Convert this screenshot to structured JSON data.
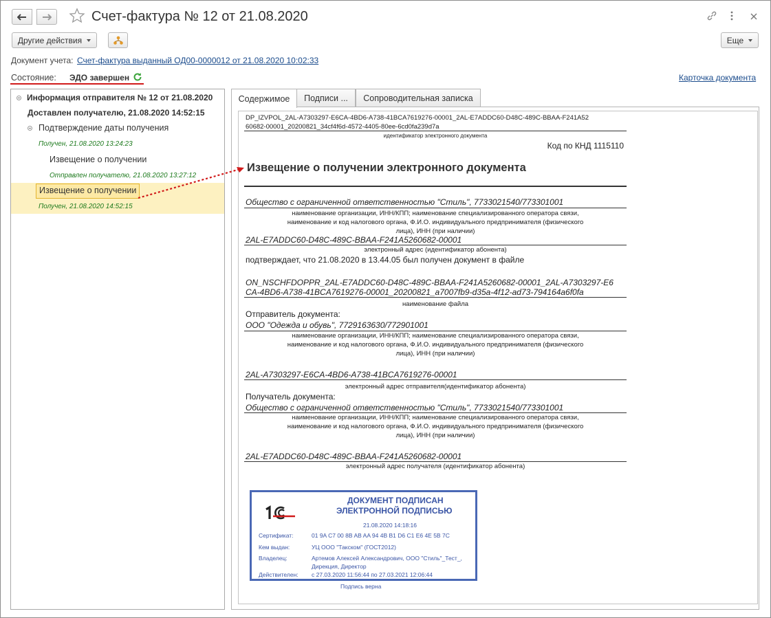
{
  "header": {
    "title": "Счет-фактура № 12 от 21.08.2020"
  },
  "toolbar": {
    "other_actions": "Другие действия",
    "more": "Еще"
  },
  "doc_account": {
    "label": "Документ учета:",
    "link": "Счет-фактура выданный ОД00-0000012 от 21.08.2020 10:02:33"
  },
  "state": {
    "label": "Состояние:",
    "value": "ЭДО завершен"
  },
  "doc_card_link": "Карточка документа",
  "tree": {
    "sender_info": "Информация отправителя № 12 от 21.08.2020",
    "delivered": "Доставлен получателю, 21.08.2020 14:52:15",
    "confirm_date": "Подтверждение даты получения",
    "received_1": "Получен, 21.08.2020 13:24:23",
    "notice_1": "Извещение о получении",
    "sent_1": "Отправлен получателю, 21.08.2020 13:27:12",
    "notice_2": "Извещение о получении",
    "received_2": "Получен, 21.08.2020 14:52:15"
  },
  "tabs": [
    "Содержимое",
    "Подписи ...",
    "Сопроводительная записка"
  ],
  "document": {
    "file_id_line1": "DP_IZVPOL_2AL-A7303297-E6CA-4BD6-A738-41BCA7619276-00001_2AL-E7ADDC60-D48C-489C-BBAA-F241A52",
    "file_id_line2": "60682-00001_20200821_34cf4f6d-4572-4405-80ee-6cd0fa239d7a",
    "file_id_caption": "идентификатор электронного документа",
    "knd": "Код по КНД 1115110",
    "heading": "Извещение о получении электронного документа",
    "org_1": "Общество с ограниченной ответственностью \"Стиль\", 7733021540/773301001",
    "org_caption_1": "наименование организации, ИНН/КПП; наименование специализированного оператора связи, наименование и код налогового органа, Ф.И.О. индивидуального предпринимателя (физического лица), ИНН (при наличии)",
    "address_1": "2AL-E7ADDC60-D48C-489C-BBAA-F241A5260682-00001",
    "address_caption_1": "электронный адрес (идентификатор абонента)",
    "confirms": "подтверждает, что 21.08.2020 в 13.44.05 был получен документ в файле",
    "filename_line1": "ON_NSCHFDOPPR_2AL-E7ADDC60-D48C-489C-BBAA-F241A5260682-00001_2AL-A7303297-E6",
    "filename_line2": "CA-4BD6-A738-41BCA7619276-00001_20200821_a7007fb9-d35a-4f12-ad73-794164a6f0fa",
    "filename_caption": "наименование файла",
    "sender_label": "Отправитель документа:",
    "sender_org": "ООО \"Одежда и обувь\", 7729163630/772901001",
    "org_caption_2": "наименование организации, ИНН/КПП; наименование специализированного оператора связи, наименование и код налогового органа, Ф.И.О. индивидуального предпринимателя (физического лица), ИНН (при наличии)",
    "sender_address": "2AL-A7303297-E6CA-4BD6-A738-41BCA7619276-00001",
    "sender_address_caption": "электронный адрес отправителя(идентификатор абонента)",
    "recipient_label": "Получатель документа:",
    "recipient_org": "Общество с ограниченной ответственностью \"Стиль\", 7733021540/773301001",
    "org_caption_3": "наименование организации, ИНН/КПП; наименование специализированного оператора связи, наименование и код налогового органа, Ф.И.О. индивидуального предпринимателя (физического лица), ИНН (при наличии)",
    "recipient_address": "2AL-E7ADDC60-D48C-489C-BBAA-F241A5260682-00001",
    "recipient_address_caption": "электронный адрес получателя (идентификатор абонента)"
  },
  "stamp": {
    "title_1": "ДОКУМЕНТ ПОДПИСАН",
    "title_2": "ЭЛЕКТРОННОЙ ПОДПИСЬЮ",
    "datetime": "21.08.2020 14:18:16",
    "cert_label": "Сертификат:",
    "cert_value": "01 9A C7 00 8B AB AA 94 4B B1 D6 C1 E6 4E 5B 7C",
    "issued_label": "Кем выдан:",
    "issued_value": "УЦ ООО \"Такском\" (ГОСТ2012)",
    "owner_label": "Владелец:",
    "owner_value_1": "Артемов Алексей Александрович, ООО \"Стиль\"_Тест_,",
    "owner_value_2": "Дирекция, Директор",
    "valid_label": "Действителен:",
    "valid_value": "с 27.03.2020 11:56:44 по 27.03.2021 12:06:44",
    "signature_ok": "Подпись верна"
  },
  "colors": {
    "link": "#1a4b8c",
    "green_status": "#1d7a1d",
    "stamp_blue": "#4a68b5",
    "highlight_row": "#fdf1c1",
    "arrow_red": "#d11a1a"
  }
}
